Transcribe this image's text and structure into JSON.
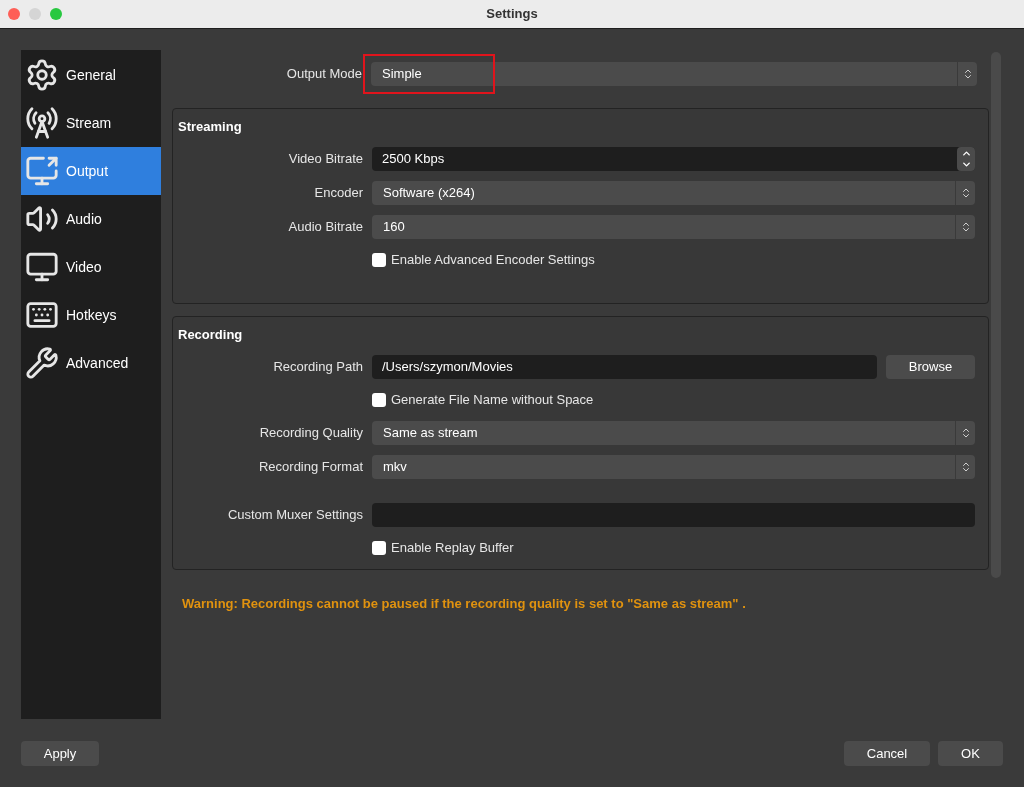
{
  "window": {
    "title": "Settings"
  },
  "sidebar": {
    "items": [
      {
        "label": "General",
        "selected": false
      },
      {
        "label": "Stream",
        "selected": false
      },
      {
        "label": "Output",
        "selected": true
      },
      {
        "label": "Audio",
        "selected": false
      },
      {
        "label": "Video",
        "selected": false
      },
      {
        "label": "Hotkeys",
        "selected": false
      },
      {
        "label": "Advanced",
        "selected": false
      }
    ]
  },
  "output_mode": {
    "label": "Output Mode",
    "value": "Simple",
    "highlighted": true
  },
  "groups": [
    {
      "title": "Streaming",
      "rows": [
        {
          "kind": "spin",
          "label": "Video Bitrate",
          "value": "2500 Kbps"
        },
        {
          "kind": "select",
          "label": "Encoder",
          "value": "Software (x264)"
        },
        {
          "kind": "select",
          "label": "Audio Bitrate",
          "value": "160"
        },
        {
          "kind": "checkbox",
          "label": "Enable Advanced Encoder Settings",
          "checked": false
        }
      ]
    },
    {
      "title": "Recording",
      "rows": [
        {
          "kind": "path",
          "label": "Recording Path",
          "value": "/Users/szymon/Movies",
          "button": "Browse"
        },
        {
          "kind": "checkbox",
          "label": "Generate File Name without Space",
          "checked": false
        },
        {
          "kind": "select",
          "label": "Recording Quality",
          "value": "Same as stream"
        },
        {
          "kind": "select",
          "label": "Recording Format",
          "value": "mkv"
        },
        {
          "kind": "text",
          "label": "Custom Muxer Settings",
          "value": ""
        },
        {
          "kind": "checkbox",
          "label": "Enable Replay Buffer",
          "checked": false
        }
      ]
    }
  ],
  "warning": "Warning: Recordings cannot be paused if the recording quality is set to \"Same as stream\" .",
  "buttons": {
    "apply": "Apply",
    "cancel": "Cancel",
    "ok": "OK"
  }
}
